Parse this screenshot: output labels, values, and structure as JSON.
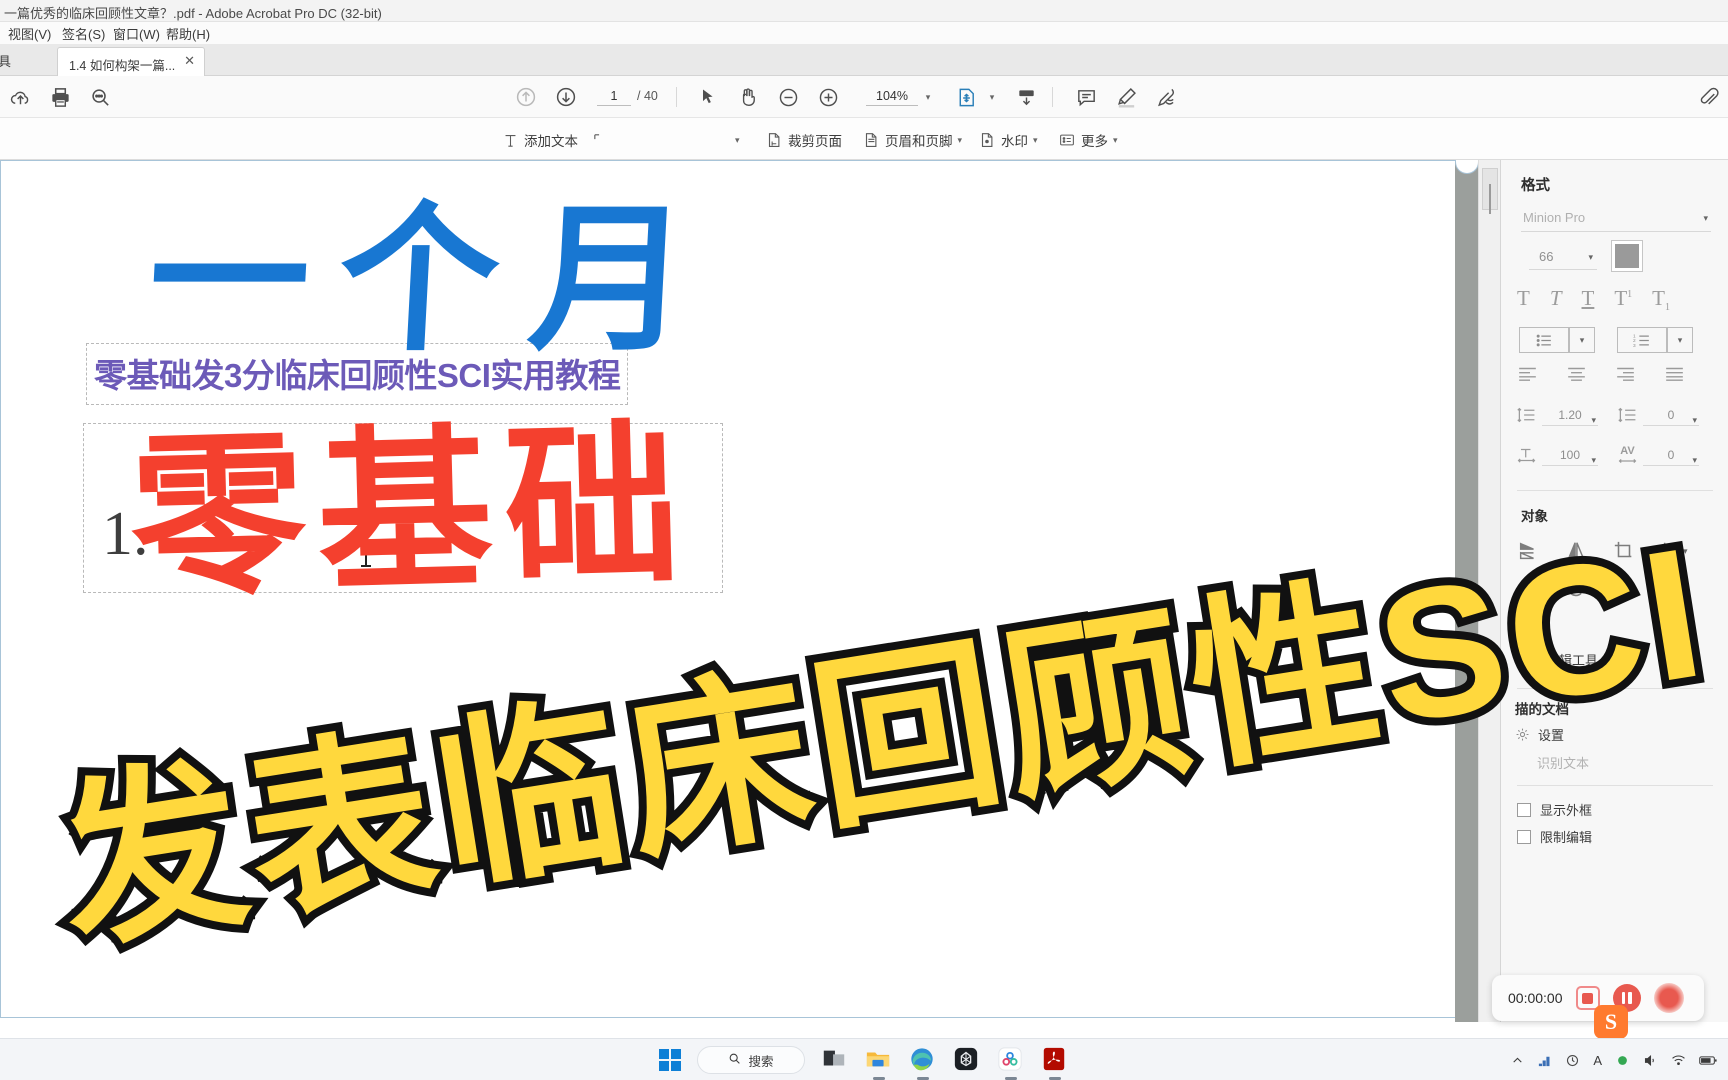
{
  "window": {
    "title": "一篇优秀的临床回顾性文章？.pdf - Adobe Acrobat Pro DC (32-bit)"
  },
  "menubar": {
    "items": [
      {
        "label": "视图(V)"
      },
      {
        "label": "签名(S)"
      },
      {
        "label": "窗口(W)"
      },
      {
        "label": "帮助(H)"
      }
    ]
  },
  "tabstrip": {
    "tools_label": "具",
    "tab_label": "1.4 如何构架一篇...",
    "close_label": "✕",
    "help_icon": "help-circle-icon",
    "bell_icon": "bell-icon"
  },
  "toolbar": {
    "upload_icon": "upload-cloud-icon",
    "print_icon": "printer-icon",
    "search_icon": "search-icon",
    "prev_page_icon": "arrow-up-circle-icon",
    "next_page_icon": "arrow-down-circle-icon",
    "page_value": "1",
    "page_total": "/ 40",
    "select_icon": "cursor-arrow-icon",
    "hand_icon": "hand-icon",
    "zoom_out_icon": "zoom-out-icon",
    "zoom_in_icon": "zoom-in-icon",
    "zoom_value": "104%",
    "zoom_caret": "▾",
    "fit_icon": "page-fit-icon",
    "fit_caret": "▾",
    "scroll_icon": "scroll-down-icon",
    "comment_icon": "comment-icon",
    "highlight_icon": "highlighter-icon",
    "sign_icon": "sign-pen-icon",
    "attach_icon": "paperclip-icon"
  },
  "edit_toolbar": {
    "items": [
      {
        "label": "添加文本",
        "icon": "add-text-icon",
        "caret": ""
      },
      {
        "label": "",
        "icon": "add-image-icon",
        "caret": "▾"
      },
      {
        "label": "裁剪页面",
        "icon": "crop-page-icon",
        "caret": ""
      },
      {
        "label": "页眉和页脚",
        "icon": "header-footer-icon",
        "caret": "▾"
      },
      {
        "label": "水印",
        "icon": "watermark-icon",
        "caret": "▾"
      },
      {
        "label": "更多",
        "icon": "more-list-icon",
        "caret": "▾"
      }
    ]
  },
  "document": {
    "heading": "零基础发3分临床回顾性SCI实用教程",
    "list_number": "1."
  },
  "overlay": {
    "line1": "一个月",
    "line2": "零基础",
    "line3": "发表临床回顾性SCI",
    "colors": {
      "blue": "#1877d2",
      "red": "#f4402e",
      "yellow": "#ffd83d",
      "yellow_stroke": "#111111",
      "heading_purple": "#6c5ab8"
    }
  },
  "format_panel": {
    "title": "格式",
    "font_name": "Minion Pro",
    "font_caret": "▾",
    "font_size": "66",
    "size_caret": "▾",
    "color_swatch": "#9a9a9a",
    "text_styles": [
      {
        "name": "bold",
        "glyph": "T"
      },
      {
        "name": "italic",
        "glyph": "T"
      },
      {
        "name": "underline",
        "glyph": "T"
      },
      {
        "name": "superscript",
        "glyph": "T"
      },
      {
        "name": "subscript",
        "glyph": "T"
      }
    ],
    "list_buttons": [
      {
        "name": "bullet-list",
        "caret": "▾"
      },
      {
        "name": "numbered-list",
        "caret": "▾"
      }
    ],
    "align_buttons": [
      "align-left",
      "align-center",
      "align-right",
      "align-justify"
    ],
    "line_spacing_value": "1.20",
    "line_spacing_caret": "▾",
    "paragraph_spacing_value": "0",
    "paragraph_spacing_caret": "▾",
    "horizontal_scale_value": "100",
    "horizontal_scale_caret": "▾",
    "tracking_label": "AV",
    "tracking_value": "0",
    "tracking_caret": "▾",
    "object_title": "对象",
    "object_buttons": [
      "flip-vertical",
      "flip-horizontal",
      "crop-object",
      "align-objects",
      "rotate-counterclockwise",
      "rotate-clockwise",
      "replace-image",
      "arrange-objects"
    ],
    "edit_tools_label": "编辑工具...",
    "scanned_doc_title": "描的文档",
    "settings_label": "设置",
    "recognize_text_label": "识别文本",
    "show_outline_label": "显示外框",
    "restrict_edit_label": "限制编辑"
  },
  "recorder": {
    "time": "00:00:00",
    "stop_icon": "stop-record-icon",
    "pause_icon": "pause-record-icon",
    "record_icon": "record-dot-icon",
    "logo_label": "S"
  },
  "taskbar": {
    "start_icon": "windows-start-icon",
    "search_placeholder": "搜索",
    "search_icon": "search-icon",
    "apps": [
      {
        "name": "task-view-icon"
      },
      {
        "name": "file-explorer-icon"
      },
      {
        "name": "edge-browser-icon"
      },
      {
        "name": "app-dark-icon"
      },
      {
        "name": "app-cloud-icon"
      },
      {
        "name": "acrobat-reader-icon"
      }
    ],
    "tray": {
      "chevron_up": "^",
      "icons": [
        "network-icon",
        "tray-app-icon",
        "ime-icon-A",
        "tray-green-icon",
        "speaker-icon",
        "wifi-icon",
        "battery-icon"
      ]
    }
  }
}
